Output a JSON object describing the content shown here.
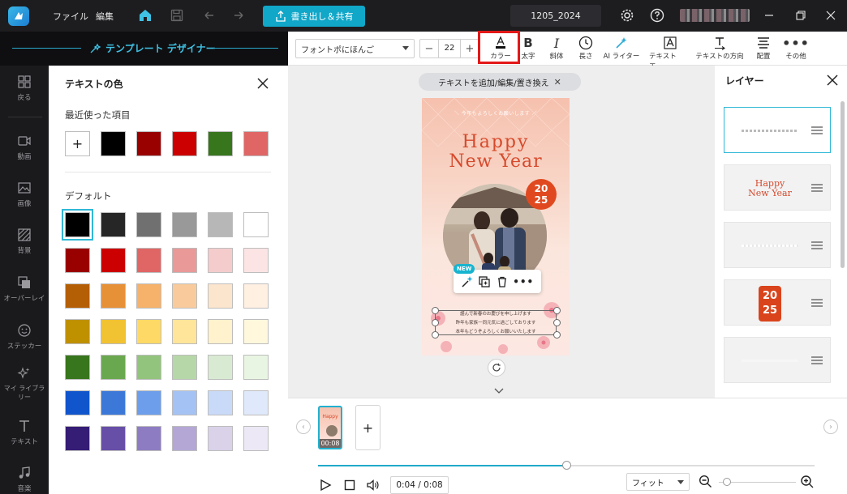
{
  "titlebar": {
    "menu_file": "ファイル",
    "menu_edit": "編集",
    "export_label": "書き出し＆共有",
    "project_name": "1205_2024"
  },
  "designer": {
    "title": "テンプレート デザイナー"
  },
  "toolbar": {
    "font_name": "フォントポにほんご",
    "font_size": "22",
    "tools": [
      {
        "label": "カラー",
        "icon": "text-color-icon"
      },
      {
        "label": "太字",
        "icon": "bold-icon"
      },
      {
        "label": "斜体",
        "icon": "italic-icon"
      },
      {
        "label": "長さ",
        "icon": "clock-icon"
      },
      {
        "label": "AI ライター",
        "icon": "magic-wand-icon"
      },
      {
        "label": "テキスト エ...",
        "icon": "text-effect-icon"
      },
      {
        "label": "テキストの方向",
        "icon": "text-direction-icon"
      },
      {
        "label": "配置",
        "icon": "align-icon"
      },
      {
        "label": "その他",
        "icon": "more-icon"
      }
    ]
  },
  "rail": {
    "items": [
      {
        "label": "戻る",
        "icon": "grid-back-icon"
      },
      {
        "label": "動画",
        "icon": "video-icon"
      },
      {
        "label": "画像",
        "icon": "image-icon"
      },
      {
        "label": "背景",
        "icon": "background-icon"
      },
      {
        "label": "オーバーレイ",
        "icon": "overlay-icon"
      },
      {
        "label": "ステッカー",
        "icon": "sticker-icon"
      },
      {
        "label": "マイ ライブラリー",
        "icon": "sparkle-library-icon"
      },
      {
        "label": "テキスト",
        "icon": "text-icon"
      },
      {
        "label": "音楽",
        "icon": "music-icon"
      }
    ]
  },
  "color_panel": {
    "title": "テキストの色",
    "recent_label": "最近使った項目",
    "recent_colors": [
      "#000000",
      "#990000",
      "#cc0000",
      "#38761d",
      "#e06666"
    ],
    "default_label": "デフォルト",
    "default_colors": [
      [
        "#000000",
        "#262626",
        "#707070",
        "#999999",
        "#b7b7b7",
        "#ffffff"
      ],
      [
        "#990000",
        "#cc0000",
        "#e06666",
        "#ea9999",
        "#f4cccc",
        "#fde4e4"
      ],
      [
        "#b45f06",
        "#e69138",
        "#f6b26b",
        "#f9cb9c",
        "#fce5cd",
        "#fff0e2"
      ],
      [
        "#bf9000",
        "#f1c232",
        "#ffd966",
        "#ffe599",
        "#fff2cc",
        "#fff8dd"
      ],
      [
        "#38761d",
        "#6aa84f",
        "#93c47d",
        "#b6d7a8",
        "#d9ead3",
        "#e8f5e2"
      ],
      [
        "#1155cc",
        "#3c78d8",
        "#6d9eeb",
        "#a4c2f4",
        "#c9daf8",
        "#dfe9fb"
      ],
      [
        "#351c75",
        "#674ea7",
        "#8e7cc3",
        "#b4a7d6",
        "#d9d2e9",
        "#ece8f5"
      ]
    ],
    "selected_color": "#000000"
  },
  "canvas": {
    "tag_label": "テキストを追加/編集/置き換え",
    "card_sub": "＼ 今年もよろしくお願いします ／",
    "card_happy": "Happy",
    "card_newyear": "New Year",
    "card_year_top": "20",
    "card_year_bottom": "25",
    "card_msg_1": "謹んで新春のお慶びを申し上げます",
    "card_msg_2": "昨年も家族一同元気に過ごしております",
    "card_msg_3": "本年もどうぞよろしくお願いいたします",
    "new_badge": "NEW"
  },
  "layers": {
    "title": "レイヤー",
    "items": [
      {
        "kind": "text-line"
      },
      {
        "kind": "title",
        "text_top": "Happy",
        "text_bottom": "New Year"
      },
      {
        "kind": "text-line"
      },
      {
        "kind": "badge",
        "text_top": "20",
        "text_bottom": "25"
      },
      {
        "kind": "text-line"
      }
    ]
  },
  "timeline": {
    "clip_duration": "00:08",
    "time_display": "0:04 / 0:08",
    "progress": 0.5,
    "zoom_label": "フィット",
    "zoom_level": 0.05
  },
  "colors": {
    "accent": "#10a7c8",
    "highlight": "#e31818"
  }
}
